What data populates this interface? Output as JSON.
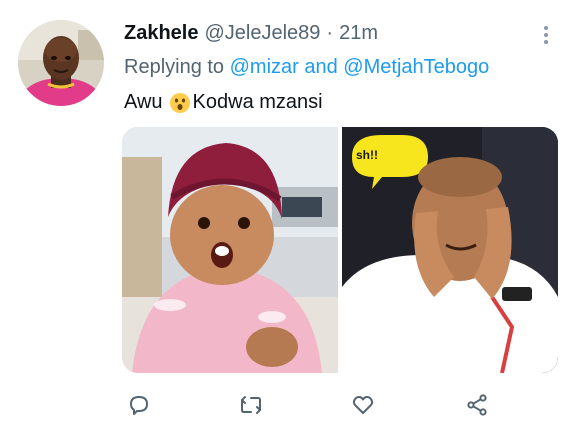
{
  "tweet": {
    "author_name": "Zakhele",
    "author_handle": "@JeleJele89",
    "separator": "·",
    "time": "21m",
    "reply_prefix": "Replying to",
    "reply_targets": "@mizar and @MetjahTebogo",
    "text_before": "Awu",
    "text_after": "Kodwa mzansi",
    "emoji": "astonished-face"
  },
  "media": {
    "left_image": "baby-in-pink-hat-surprised",
    "right_image": "man-hands-on-face-shocked",
    "speech_fragment": "sh!!"
  },
  "actions": {
    "reply_icon": "reply-icon",
    "retweet_icon": "retweet-icon",
    "like_icon": "heart-icon",
    "share_icon": "share-icon"
  },
  "colors": {
    "accent": "#1d9bf0",
    "secondary_text": "#536471",
    "primary_text": "#0f1419"
  }
}
